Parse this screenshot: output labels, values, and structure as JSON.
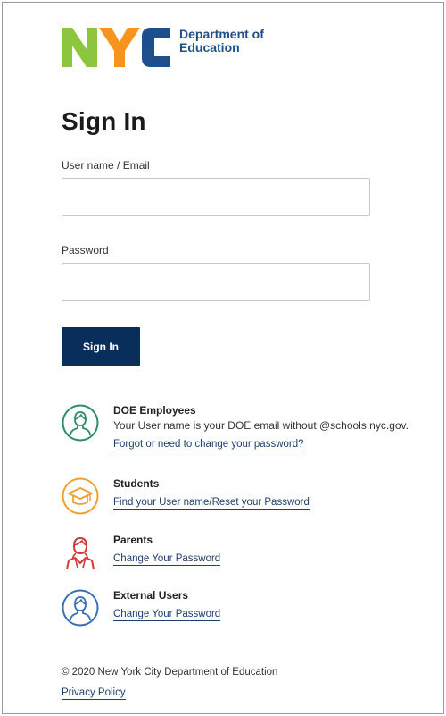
{
  "logo": {
    "letters": "NYC",
    "line1": "Department of",
    "line2": "Education",
    "colors": {
      "n": "#8cc63f",
      "y": "#f7941d",
      "c": "#1d4f8e",
      "text": "#1d4f8e"
    }
  },
  "title": "Sign In",
  "form": {
    "username_label": "User name / Email",
    "username_value": "",
    "password_label": "Password",
    "password_value": "",
    "submit_label": "Sign In"
  },
  "groups": [
    {
      "heading": "DOE Employees",
      "description": "Your User name is your DOE email without @schools.nyc.gov.",
      "link": "Forgot or need to change your password?",
      "icon": "employee-icon",
      "color": "#2e8b6e"
    },
    {
      "heading": "Students",
      "description": "",
      "link": "Find your User name/Reset your Password",
      "icon": "graduation-cap-icon",
      "color": "#f0a030"
    },
    {
      "heading": "Parents",
      "description": "",
      "link": "Change Your Password",
      "icon": "parent-icon",
      "color": "#d23a3a"
    },
    {
      "heading": "External Users",
      "description": "",
      "link": "Change Your Password",
      "icon": "external-user-icon",
      "color": "#3a6fb0"
    }
  ],
  "footer": {
    "copyright": "© 2020 New York City Department of Education",
    "privacy_link": "Privacy Policy"
  },
  "colors": {
    "primary_button": "#0a2e5c",
    "link": "#1f3f6e"
  }
}
